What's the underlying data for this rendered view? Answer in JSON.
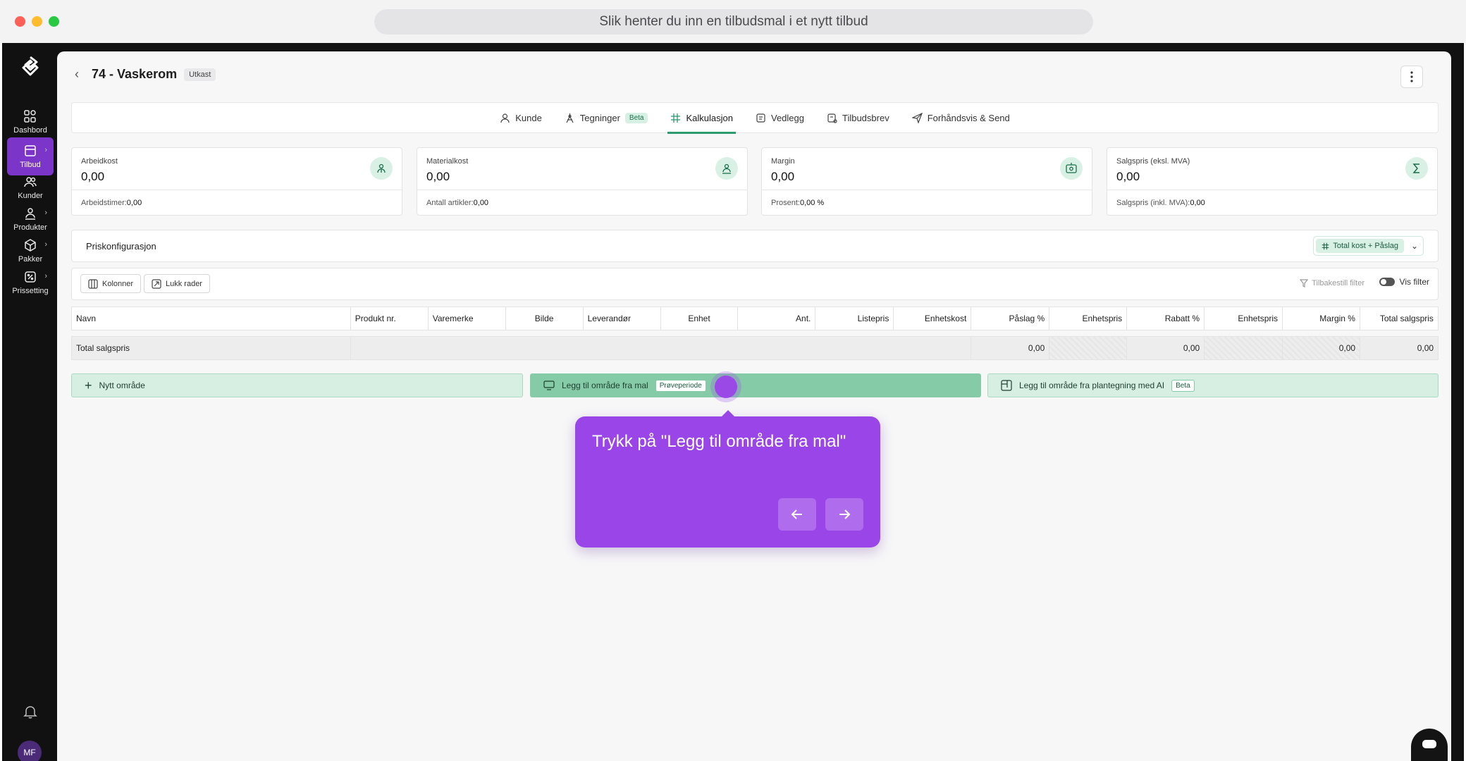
{
  "browser": {
    "url_title": "Slik henter du inn en tilbudsmal i et nytt tilbud"
  },
  "sidebar": {
    "items": [
      {
        "label": "Dashbord",
        "icon": "dashboard-icon",
        "active": false
      },
      {
        "label": "Tilbud",
        "icon": "offer-icon",
        "active": true
      },
      {
        "label": "Kunder",
        "icon": "customers-icon",
        "active": false
      },
      {
        "label": "Produkter",
        "icon": "products-icon",
        "active": false
      },
      {
        "label": "Pakker",
        "icon": "package-icon",
        "active": false
      },
      {
        "label": "Prissetting",
        "icon": "pricing-icon",
        "active": false
      }
    ],
    "avatar_initials": "MF"
  },
  "header": {
    "title": "74 - Vaskerom",
    "status": "Utkast"
  },
  "tabs": [
    {
      "label": "Kunde",
      "icon": "user-icon"
    },
    {
      "label": "Tegninger",
      "icon": "drawing-icon",
      "badge": "Beta"
    },
    {
      "label": "Kalkulasjon",
      "icon": "calculator-icon",
      "active": true
    },
    {
      "label": "Vedlegg",
      "icon": "attachment-icon"
    },
    {
      "label": "Tilbudsbrev",
      "icon": "letter-icon"
    },
    {
      "label": "Forhåndsvis & Send",
      "icon": "send-icon"
    }
  ],
  "cards": [
    {
      "label": "Arbeidkost",
      "value": "0,00",
      "sub_label": "Arbeidstimer:",
      "sub_value": "0,00",
      "icon": "worker-icon"
    },
    {
      "label": "Materialkost",
      "value": "0,00",
      "sub_label": "Antall artikler:",
      "sub_value": "0,00",
      "icon": "material-icon"
    },
    {
      "label": "Margin",
      "value": "0,00",
      "sub_label": "Prosent:",
      "sub_value": "0,00 %",
      "icon": "money-icon"
    },
    {
      "label": "Salgspris (eksl. MVA)",
      "value": "0,00",
      "sub_label": "Salgspris (inkl. MVA):",
      "sub_value": "0,00",
      "icon": "sigma-icon"
    }
  ],
  "pricing": {
    "title": "Priskonfigurasjon",
    "selected": "Total kost + Påslag"
  },
  "toolbar": {
    "columns": "Kolonner",
    "close_rows": "Lukk rader",
    "reset_filter": "Tilbakestill filter",
    "show_filter": "Vis filter"
  },
  "table": {
    "headers": [
      "Navn",
      "Produkt nr.",
      "Varemerke",
      "Bilde",
      "Leverandør",
      "Enhet",
      "Ant.",
      "Listepris",
      "Enhetskost",
      "Påslag %",
      "Enhetspris",
      "Rabatt %",
      "Enhetspris",
      "Margin %",
      "Total salgspris"
    ],
    "total_label": "Total salgspris",
    "totals": [
      "0,00",
      "0,00",
      "0,00",
      "0,00"
    ]
  },
  "area_buttons": {
    "new_area": "Nytt område",
    "from_template": "Legg til område fra mal",
    "template_tag": "Prøveperiode",
    "from_ai": "Legg til område fra plantegning med AI",
    "ai_tag": "Beta"
  },
  "tooltip": {
    "text": "Trykk på \"Legg til område fra mal\""
  },
  "colors": {
    "accent_purple": "#9945e8",
    "accent_green": "#2e9b6e",
    "sidebar_bg": "#111111"
  }
}
